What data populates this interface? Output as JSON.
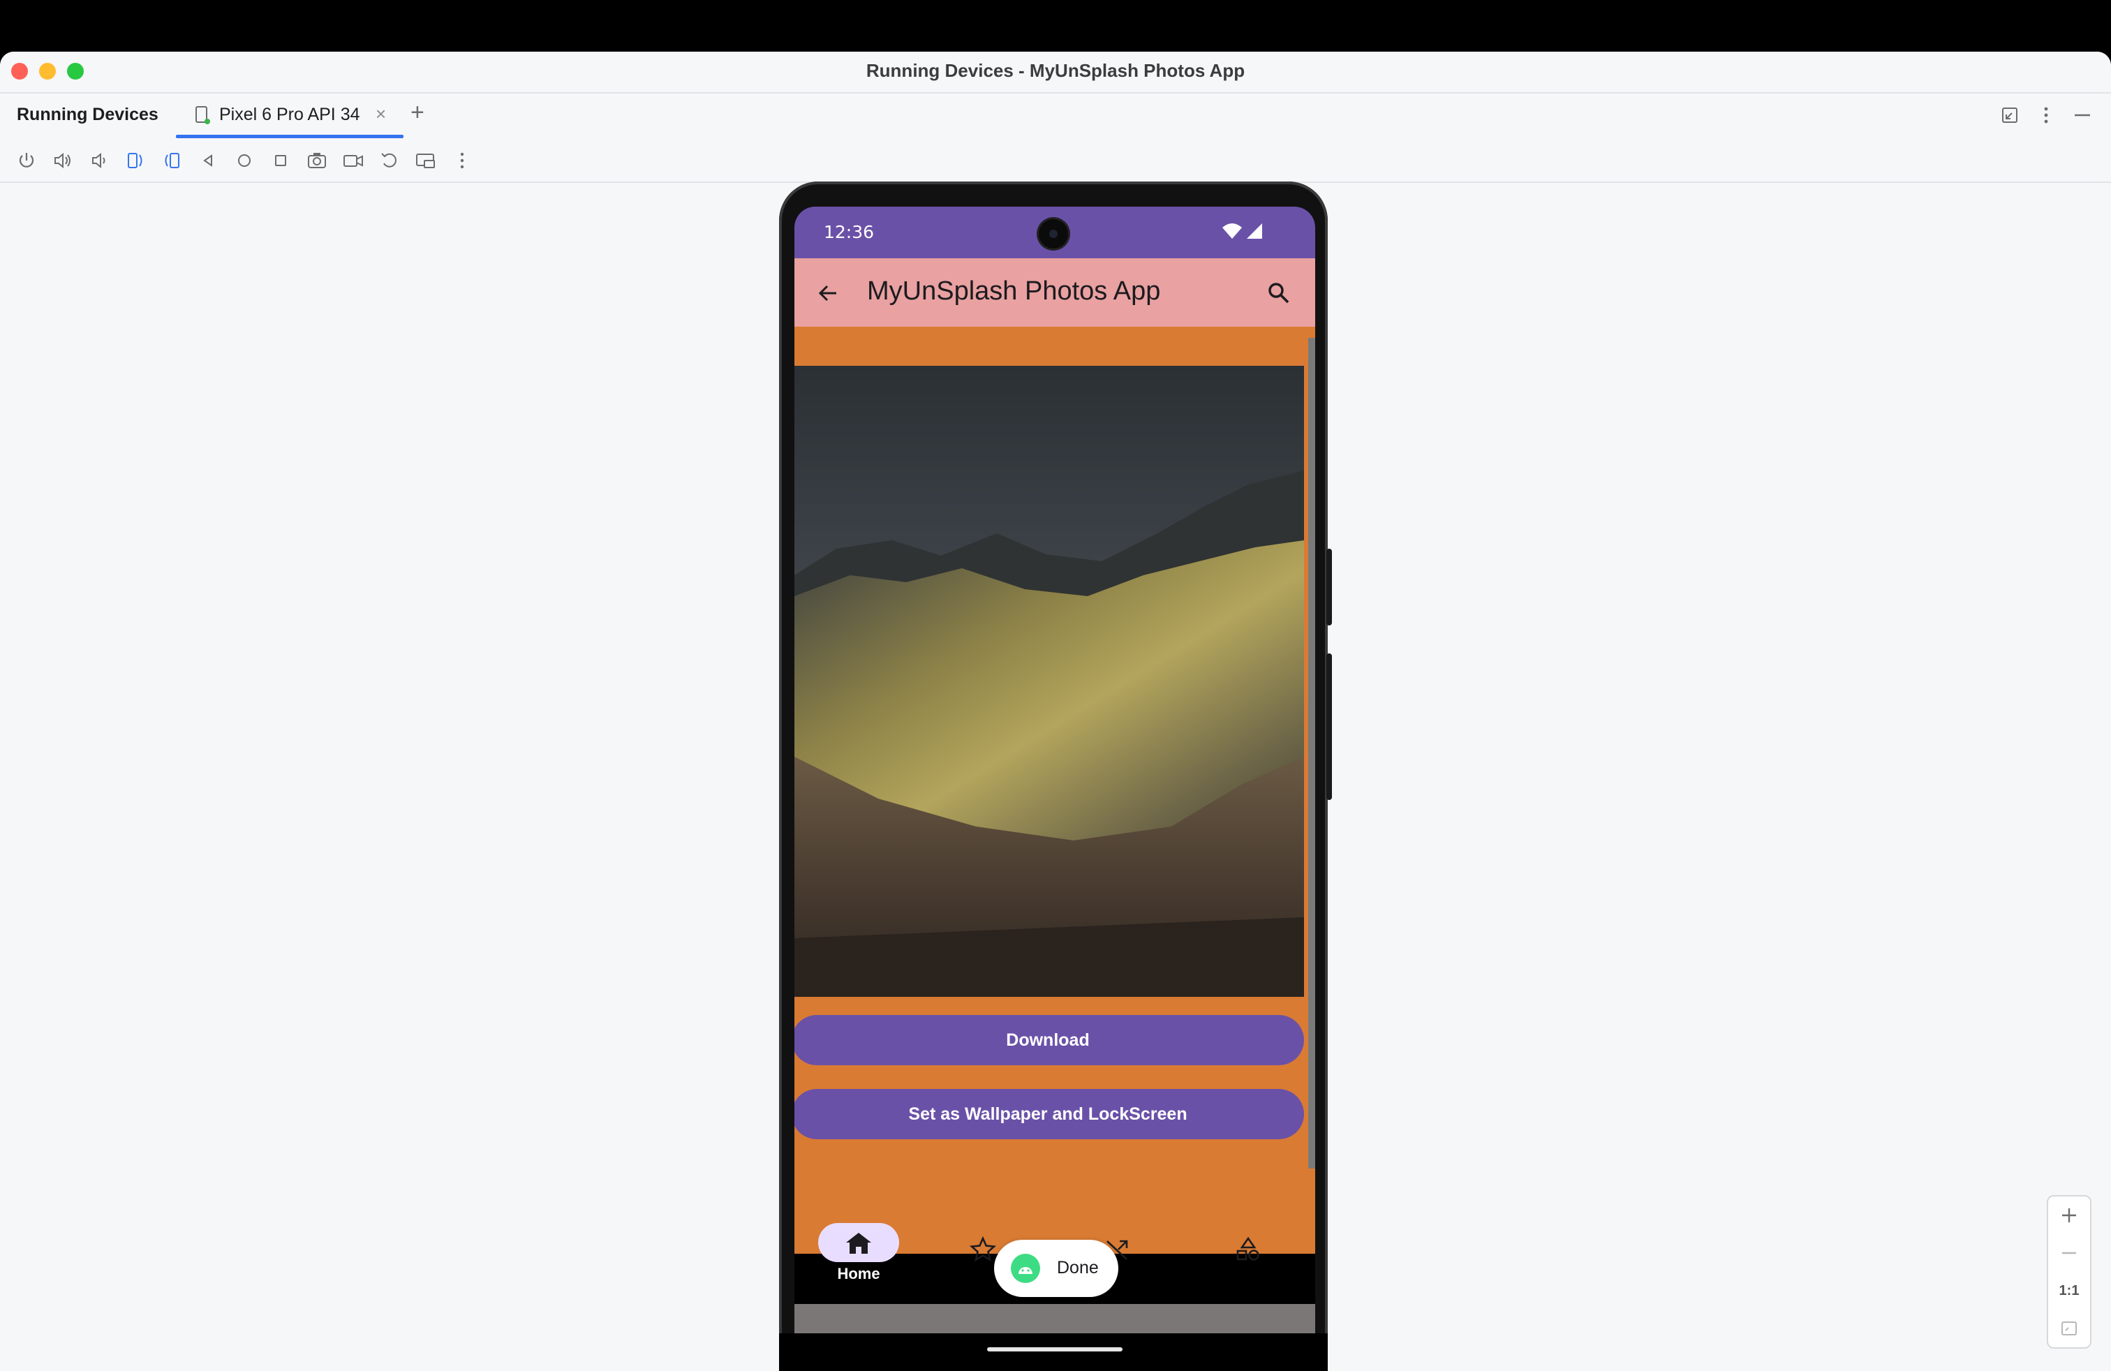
{
  "window": {
    "title": "Running Devices - MyUnSplash Photos App"
  },
  "panel": {
    "title": "Running Devices"
  },
  "tab": {
    "label": "Pixel 6 Pro API 34",
    "close": "×",
    "add": "+"
  },
  "toolbar": {
    "icons": [
      "power-icon",
      "volume-up-icon",
      "volume-down-icon",
      "rotate-left-icon",
      "rotate-right-icon",
      "back-icon",
      "home-icon",
      "overview-icon",
      "screenshot-icon",
      "screen-record-icon",
      "reset-icon",
      "mirror-icon",
      "more-icon"
    ]
  },
  "device": {
    "status": {
      "time": "12:36"
    },
    "app_title": "MyUnSplash Photos App",
    "buttons": {
      "download": "Download",
      "wallpaper": "Set as Wallpaper and LockScreen"
    },
    "nav": {
      "home": "Home"
    },
    "toast": {
      "label": "Done"
    }
  },
  "zoom": {
    "ratio": "1:1"
  },
  "colors": {
    "status_bar": "#6a51a8",
    "app_bar": "#e9a1a1",
    "content_bg": "#d97b33",
    "button": "#6a51a8",
    "nav_pill": "#e9ddff",
    "tab_underline": "#3574f0"
  }
}
